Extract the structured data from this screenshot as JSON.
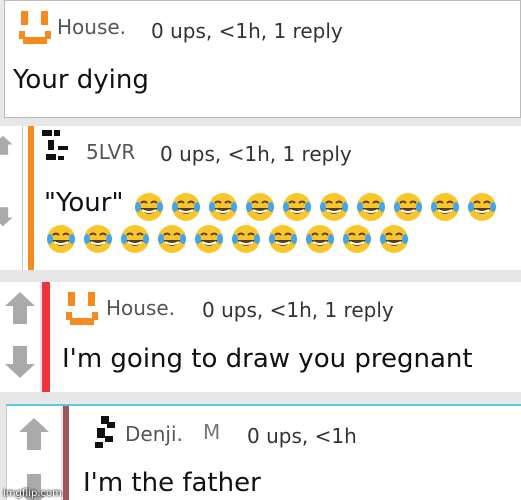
{
  "comments": [
    {
      "author": "House.",
      "meta": "0 ups, <1h, 1 reply",
      "text": "Your dying"
    },
    {
      "author": "5LVR",
      "meta": "0 ups, <1h, 1 reply",
      "text": "\"Your\"",
      "emoji_row1_count": 10,
      "emoji_row2_count": 10,
      "emoji": "face-with-tears-of-joy"
    },
    {
      "author": "House.",
      "meta": "0 ups, <1h, 1 reply",
      "text": "I'm going to draw you pregnant",
      "bar_color": "#f0343a"
    },
    {
      "author": "Denji.",
      "badge": "M",
      "meta": "0 ups, <1h",
      "text": "I'm the father",
      "bar_color": "#9e5a5a",
      "border_color": "#56c8e0"
    }
  ],
  "accent_orange": "#f58a1f",
  "watermark": "imgflip.com"
}
